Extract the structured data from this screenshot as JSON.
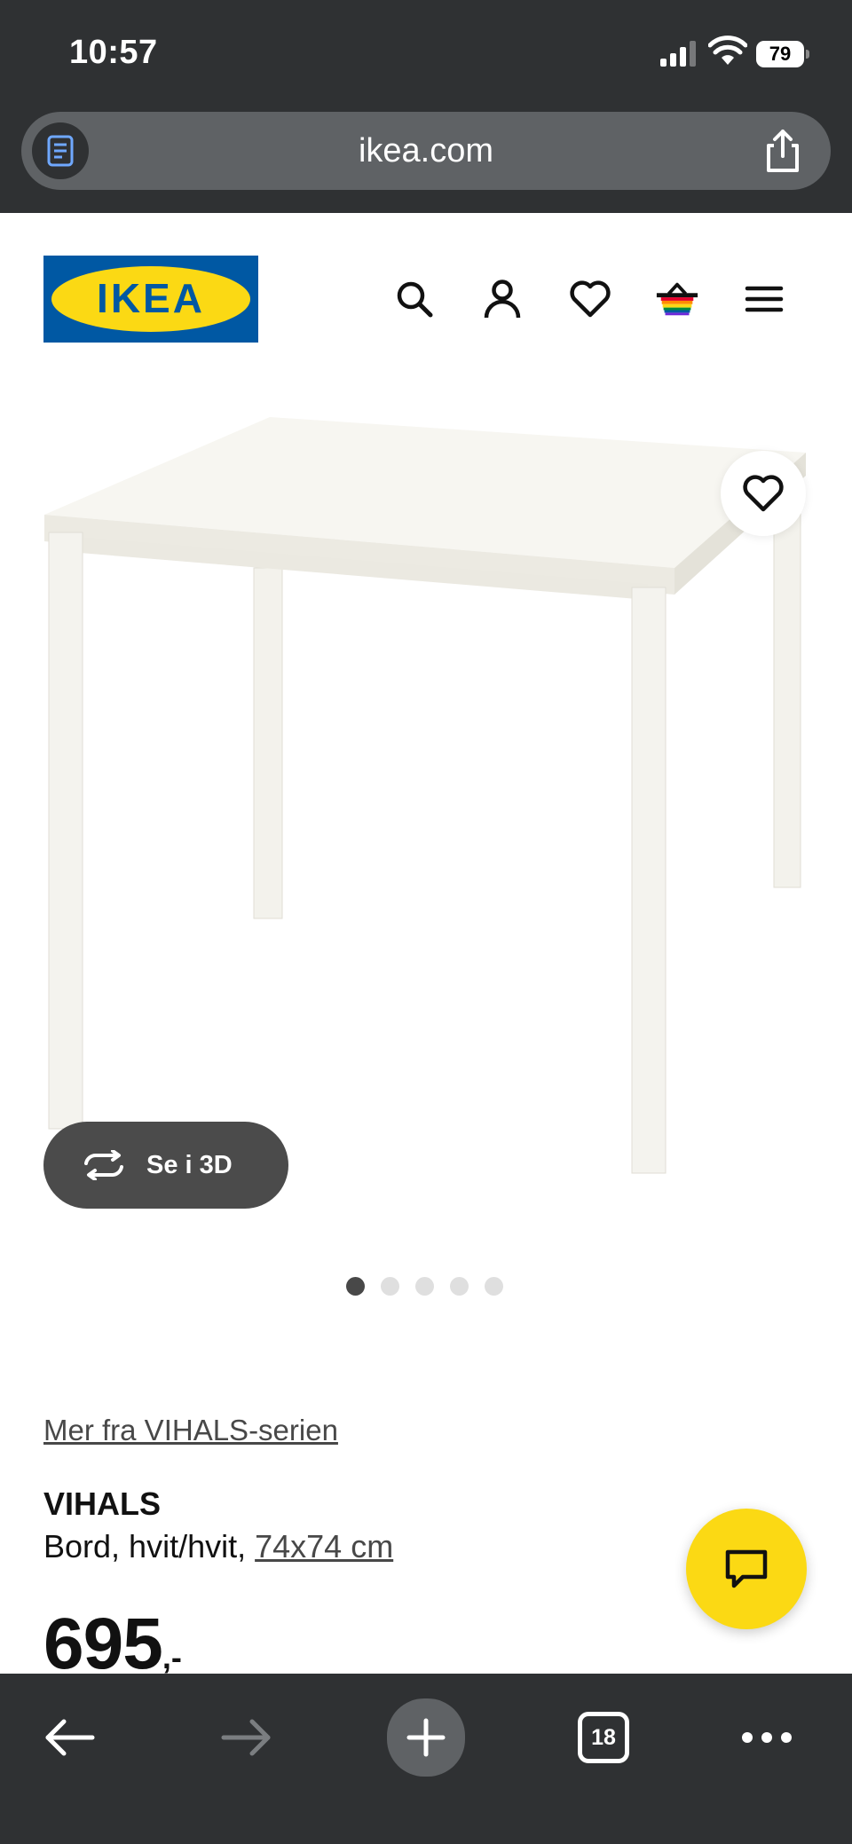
{
  "status_bar": {
    "time": "10:57",
    "battery": "79"
  },
  "browser": {
    "url": "ikea.com",
    "tab_count": "18"
  },
  "header": {
    "logo_text": "IKEA",
    "icons": [
      "search-icon",
      "account-icon",
      "wishlist-heart-icon",
      "shopping-bag-icon",
      "menu-icon"
    ]
  },
  "product": {
    "view_3d_label": "Se i 3D",
    "image_count": 5,
    "active_image": 1,
    "series_link": "Mer fra VIHALS-serien",
    "name": "VIHALS",
    "description": "Bord, hvit/hvit, ",
    "size": "74x74 cm",
    "price": "695",
    "price_suffix": ",-"
  },
  "colors": {
    "ikea_blue": "#0058a3",
    "ikea_yellow": "#fbd914",
    "chrome": "#2f3133"
  }
}
